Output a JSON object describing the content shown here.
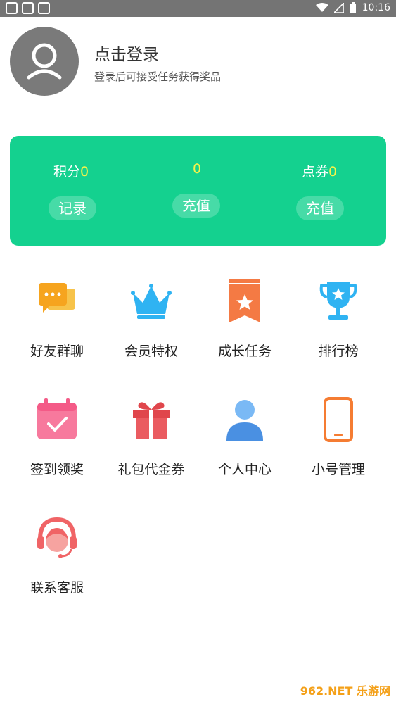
{
  "status_bar": {
    "time": "10:16"
  },
  "profile": {
    "title": "点击登录",
    "subtitle": "登录后可接受任务获得奖品"
  },
  "card": {
    "points_label": "积分",
    "points_value": "0",
    "middle_value": "0",
    "coupon_label": "点券",
    "coupon_value": "0",
    "record_button": "记录",
    "recharge_button": "充值",
    "recharge_button_2": "充值"
  },
  "menu": [
    {
      "label": "好友群聊",
      "icon": "chat-icon"
    },
    {
      "label": "会员特权",
      "icon": "crown-icon"
    },
    {
      "label": "成长任务",
      "icon": "bookmark-star-icon"
    },
    {
      "label": "排行榜",
      "icon": "trophy-icon"
    },
    {
      "label": "签到领奖",
      "icon": "calendar-check-icon"
    },
    {
      "label": "礼包代金券",
      "icon": "gift-icon"
    },
    {
      "label": "个人中心",
      "icon": "person-icon"
    },
    {
      "label": "小号管理",
      "icon": "phone-icon"
    },
    {
      "label": "联系客服",
      "icon": "headset-icon"
    }
  ],
  "watermark": "962.NET 乐游网"
}
